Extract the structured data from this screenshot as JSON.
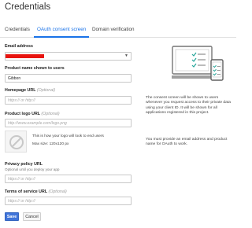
{
  "page": {
    "title": "Credentials"
  },
  "tabs": [
    {
      "label": "Credentials"
    },
    {
      "label": "OAuth consent screen"
    },
    {
      "label": "Domain verification"
    }
  ],
  "form": {
    "email": {
      "label": "Email address"
    },
    "product_name": {
      "label": "Product name shown to users",
      "value": "Gibbon"
    },
    "homepage": {
      "label": "Homepage URL",
      "optional": "(Optional)",
      "placeholder": "https:// or http://"
    },
    "logo_url": {
      "label": "Product logo URL",
      "optional": "(Optional)",
      "placeholder": "http://www.example.com/logo.png"
    },
    "logo_hint": {
      "line1": "This is how your logo will look to end users",
      "line2": "Max size: 120x120 px"
    },
    "privacy": {
      "label": "Privacy policy URL",
      "sublabel": "Optional until you deploy your app",
      "placeholder": "https:// or http://"
    },
    "terms": {
      "label": "Terms of service URL",
      "optional": "(Optional)",
      "placeholder": "https:// or http://"
    }
  },
  "buttons": {
    "save": "Save",
    "cancel": "Cancel"
  },
  "info": {
    "paragraph1": "The consent screen will be shown to users whenever you request access to their private data using your client ID. It will be shown for all applications registered in this project.",
    "paragraph2": "You must provide an email address and product name for OAuth to work."
  },
  "colors": {
    "accent": "#1a73e8",
    "redacted": "#e8140f",
    "save_button": "#3f74d9"
  },
  "icons": {
    "illustration": "laptop-and-phone-checklist",
    "logo_placeholder": "no-image-icon",
    "dropdown": "caret-down-icon"
  }
}
